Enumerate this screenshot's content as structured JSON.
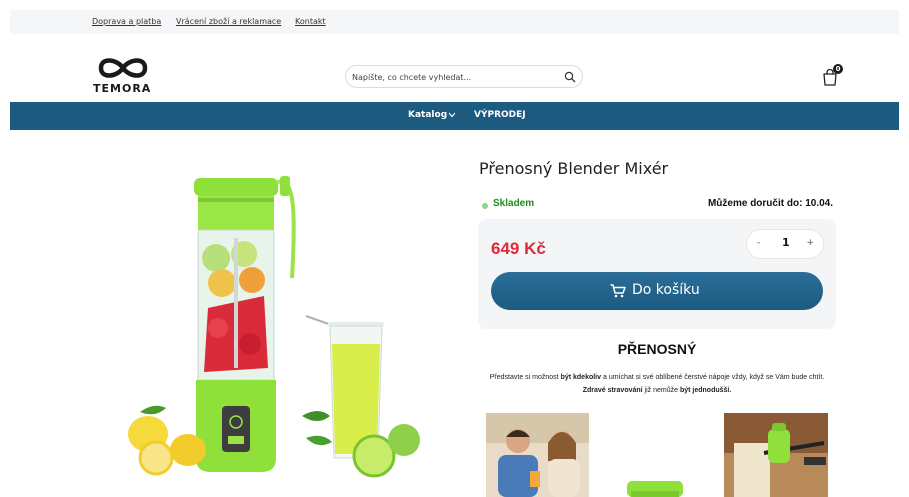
{
  "topbar": {
    "links": [
      "Doprava a platba",
      "Vrácení zboží a reklamace",
      "Kontakt"
    ]
  },
  "logo": {
    "text": "TEMORA",
    "icon": "infinity-logo-icon"
  },
  "search": {
    "placeholder": "Napište, co chcete vyhledat...",
    "icon": "search-icon"
  },
  "cart": {
    "count": "0",
    "icon": "shopping-bag-icon"
  },
  "nav": {
    "catalog": "Katalog",
    "sale": "VÝPRODEJ"
  },
  "product": {
    "title": "Přenosný Blender Mixér",
    "stock": "Skladem",
    "delivery": "Můžeme doručit do: 10.04.",
    "price": "649 Kč",
    "quantity": "1",
    "qty_minus": "-",
    "qty_plus": "+",
    "add_to_cart": "Do košíku"
  },
  "section": {
    "heading": "PŘENOSNÝ",
    "desc_1": "Představte si možnost ",
    "desc_b1": "být kdekoliv",
    "desc_2": " a umíchat si své oblíbené čerstvé nápoje vždy, když se Vám bude chtít. ",
    "desc_b2": "Zdravé stravování",
    "desc_3": " již nemůže ",
    "desc_b3": "být jednodušší."
  },
  "colors": {
    "nav": "#1d5a80",
    "price": "#e0283c",
    "stock": "#1a8f1a",
    "blender": "#8fe03a"
  }
}
